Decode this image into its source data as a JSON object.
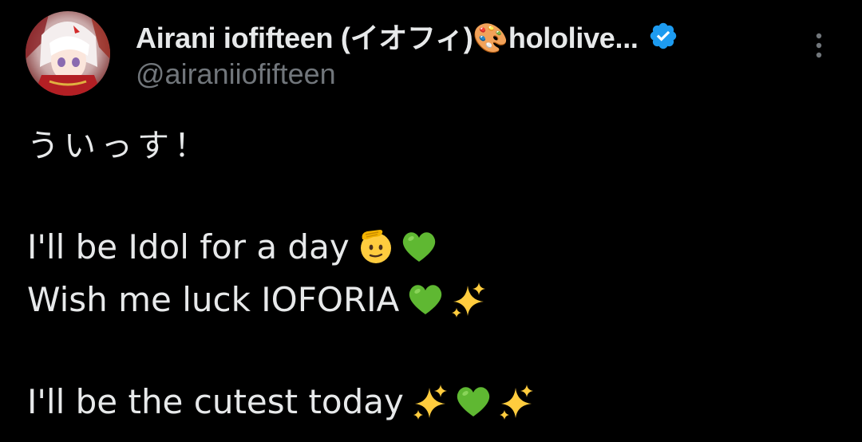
{
  "author": {
    "display_name": "Airani iofifteen (イオフィ)🎨hololive...",
    "handle": "@airaniiofifteen",
    "verified": true,
    "verified_color": "#1d9bf0"
  },
  "post": {
    "line1": "ういっす！",
    "line2": "I'll be Idol for a day",
    "line3": "Wish me luck IOFORIA",
    "line4": "I'll be the cutest today"
  },
  "icons": {
    "salute": "saluting-face-emoji",
    "green_heart": "green-heart-emoji",
    "sparkles": "sparkles-emoji",
    "more": "more-options-icon"
  },
  "colors": {
    "background": "#000000",
    "text": "#e7e9ea",
    "secondary_text": "#71767b",
    "heart_green": "#5fb832",
    "sparkle_yellow": "#ffcc3e"
  }
}
